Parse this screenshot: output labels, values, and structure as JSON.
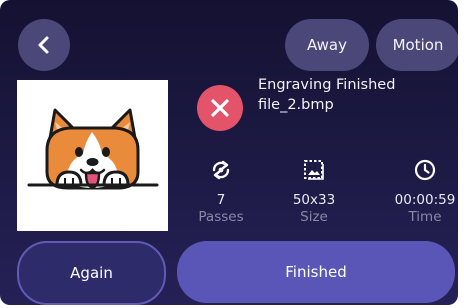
{
  "header": {
    "away_label": "Away",
    "motion_label": "Motion"
  },
  "job": {
    "status_title": "Engraving Finished",
    "file_name": "file_2.bmp"
  },
  "stats": {
    "passes": {
      "value": "7",
      "label": "Passes"
    },
    "size": {
      "value": "50x33",
      "label": "Size"
    },
    "time": {
      "value": "00:00:59",
      "label": "Time"
    }
  },
  "actions": {
    "again_label": "Again",
    "finished_label": "Finished"
  },
  "icons": {
    "back": "chevron-left-icon",
    "status": "close-icon",
    "passes": "repeat-icon",
    "size": "image-size-icon",
    "time": "clock-icon"
  },
  "colors": {
    "background": "#1d1a45",
    "pill_button": "#4b4778",
    "error_red": "#e3546a",
    "primary_button": "#5a56b8",
    "secondary_button": "#2e2b6a"
  }
}
